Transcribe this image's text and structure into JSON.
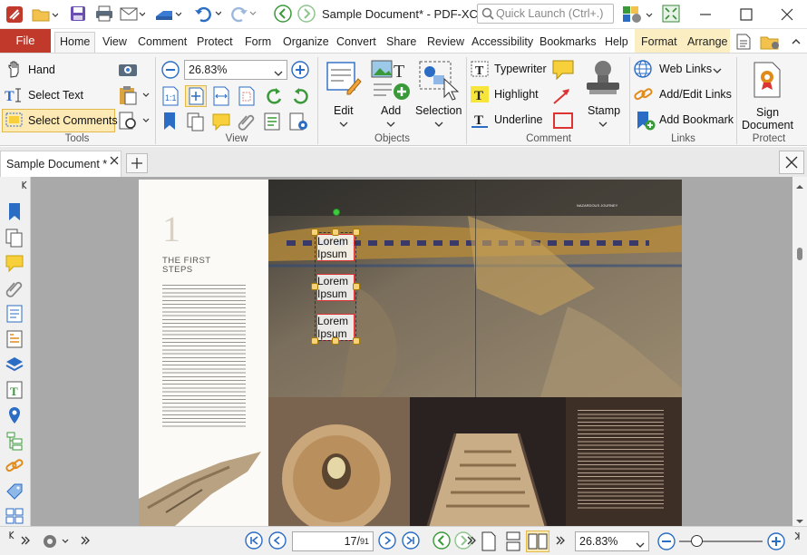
{
  "title": "Sample Document* - PDF-XCh...",
  "quick_launch_placeholder": "Quick Launch (Ctrl+.)",
  "menu": {
    "file": "File",
    "tabs": [
      "Home",
      "View",
      "Comment",
      "Protect",
      "Form",
      "Organize",
      "Convert",
      "Share",
      "Review",
      "Accessibility",
      "Bookmarks",
      "Help"
    ],
    "context_tabs": [
      "Format",
      "Arrange"
    ]
  },
  "ribbon": {
    "tools": {
      "hand": "Hand",
      "select_text": "Select Text",
      "select_comments": "Select Comments",
      "label": "Tools"
    },
    "view": {
      "zoom": "26.83%",
      "label": "View"
    },
    "objects": {
      "edit": "Edit",
      "add": "Add",
      "selection": "Selection",
      "label": "Objects"
    },
    "comment": {
      "typewriter": "Typewriter",
      "highlight": "Highlight",
      "underline": "Underline",
      "stamp": "Stamp",
      "label": "Comment"
    },
    "links": {
      "web_links": "Web Links",
      "add_edit_links": "Add/Edit Links",
      "add_bookmark": "Add Bookmark",
      "label": "Links"
    },
    "protect": {
      "sign_document_line1": "Sign",
      "sign_document_line2": "Document",
      "label": "Protect"
    }
  },
  "doc_tab": {
    "label": "Sample Document *"
  },
  "page": {
    "chapter_number": "1",
    "chapter_title_line1": "THE FIRST",
    "chapter_title_line2": "STEPS",
    "annotations": [
      {
        "line1": "Lorem",
        "line2": "Ipsum"
      },
      {
        "line1": "Lorem",
        "line2": "Ipsum"
      },
      {
        "line1": "Lorem",
        "line2": "Ipsum"
      }
    ]
  },
  "status": {
    "current_page": "17",
    "page_count": "91",
    "zoom": "26.83%"
  },
  "colors": {
    "file_tab": "#c0392b",
    "accent": "#1e6fc4",
    "selected_tool": "#fde9b4",
    "ribbon_bg": "#f5f5f5"
  }
}
